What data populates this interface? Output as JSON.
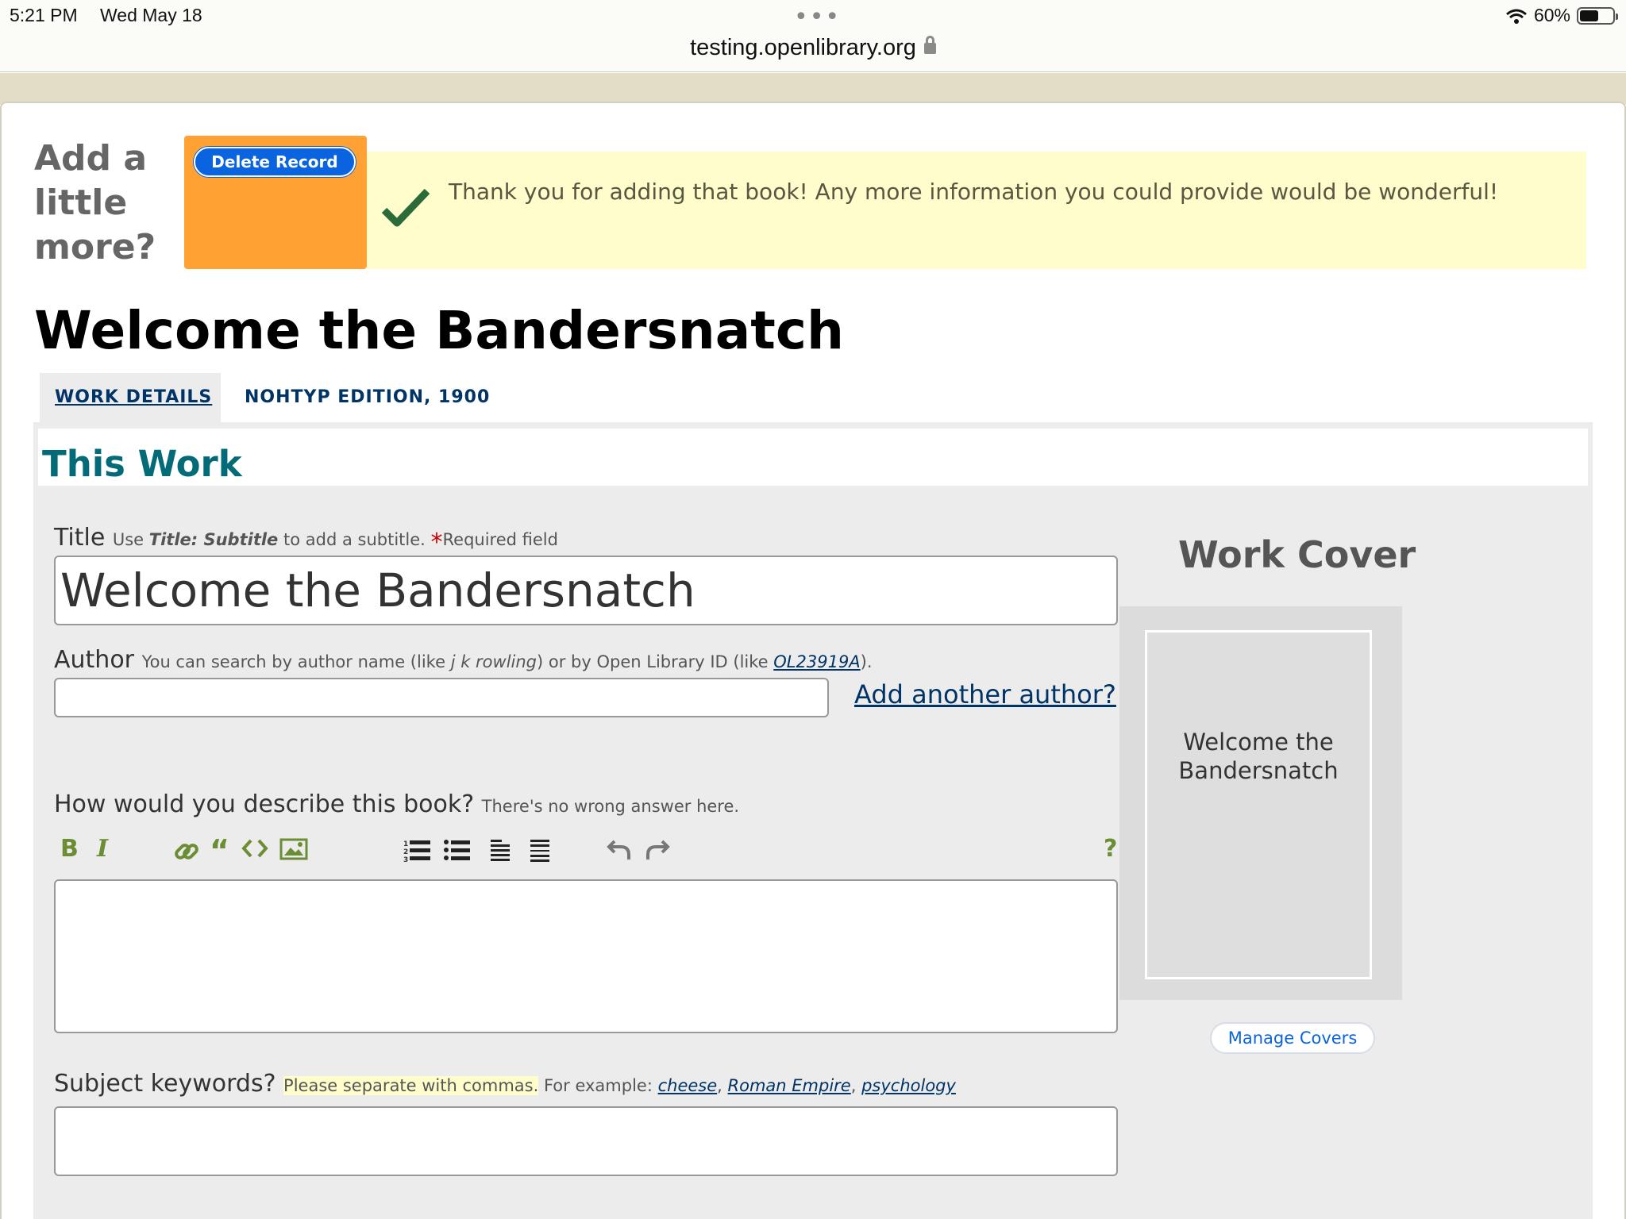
{
  "status": {
    "time": "5:21 PM",
    "date": "Wed May 18",
    "url": "testing.openlibrary.org",
    "battery": "60%"
  },
  "header": {
    "add_more": "Add a little more?",
    "delete_label": "Delete Record",
    "flash_message": "Thank you for adding that book! Any more information you could provide would be wonderful!"
  },
  "book_title": "Welcome the Bandersnatch",
  "tabs": [
    {
      "label": "WORK DETAILS"
    },
    {
      "label": "NOHTYP EDITION, 1900"
    }
  ],
  "section_title": "This Work",
  "form": {
    "title_label": "Title",
    "title_hint_pre": "Use",
    "title_hint_em": "Title: Subtitle",
    "title_hint_post": "to add a subtitle.",
    "required_mark": "*",
    "required_text": "Required field",
    "title_value": "Welcome the Bandersnatch",
    "author_label": "Author",
    "author_hint_pre": "You can search by author name (like",
    "author_hint_em": "j k rowling",
    "author_hint_mid": ") or by Open Library ID (like",
    "author_hint_link": "OL23919A",
    "author_hint_post": ").",
    "author_value": "",
    "add_author": "Add another author?",
    "desc_label": "How would you describe this book?",
    "desc_hint": "There's no wrong answer here.",
    "desc_value": "",
    "subject_label": "Subject keywords?",
    "subject_hint_hl": "Please separate with commas.",
    "subject_hint": "For example:",
    "subject_examples": [
      "cheese",
      "Roman Empire",
      "psychology"
    ],
    "subject_value": ""
  },
  "toolbar": {
    "bold": "B",
    "italic": "I",
    "help": "?"
  },
  "cover": {
    "heading": "Work Cover",
    "placeholder_text": "Welcome the Bandersnatch",
    "manage_label": "Manage Covers"
  }
}
